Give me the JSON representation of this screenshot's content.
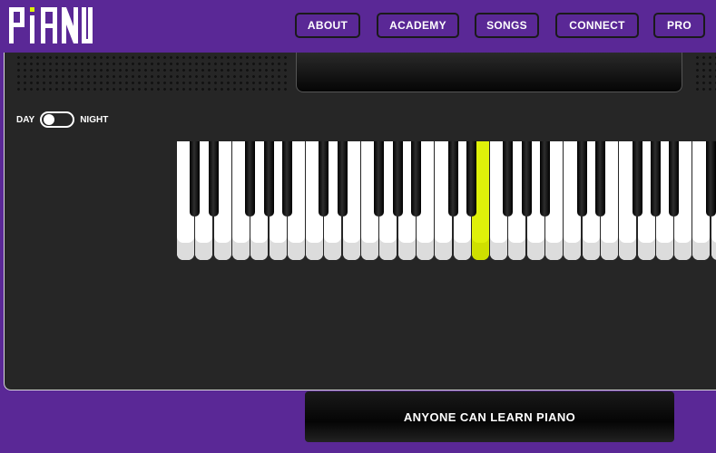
{
  "app": {
    "logo_text": "PIANU",
    "accent_color": "#dff10a",
    "brand_color": "#5a2896"
  },
  "nav": [
    {
      "label": "ABOUT"
    },
    {
      "label": "ACADEMY"
    },
    {
      "label": "SONGS"
    },
    {
      "label": "CONNECT"
    },
    {
      "label": "PRO"
    }
  ],
  "theme_toggle": {
    "left_label": "DAY",
    "right_label": "NIGHT",
    "selected": "DAY"
  },
  "keyboard": {
    "white_key_count": 30,
    "active_key": "white key 17"
  },
  "tagline": "ANYONE CAN LEARN PIANO"
}
